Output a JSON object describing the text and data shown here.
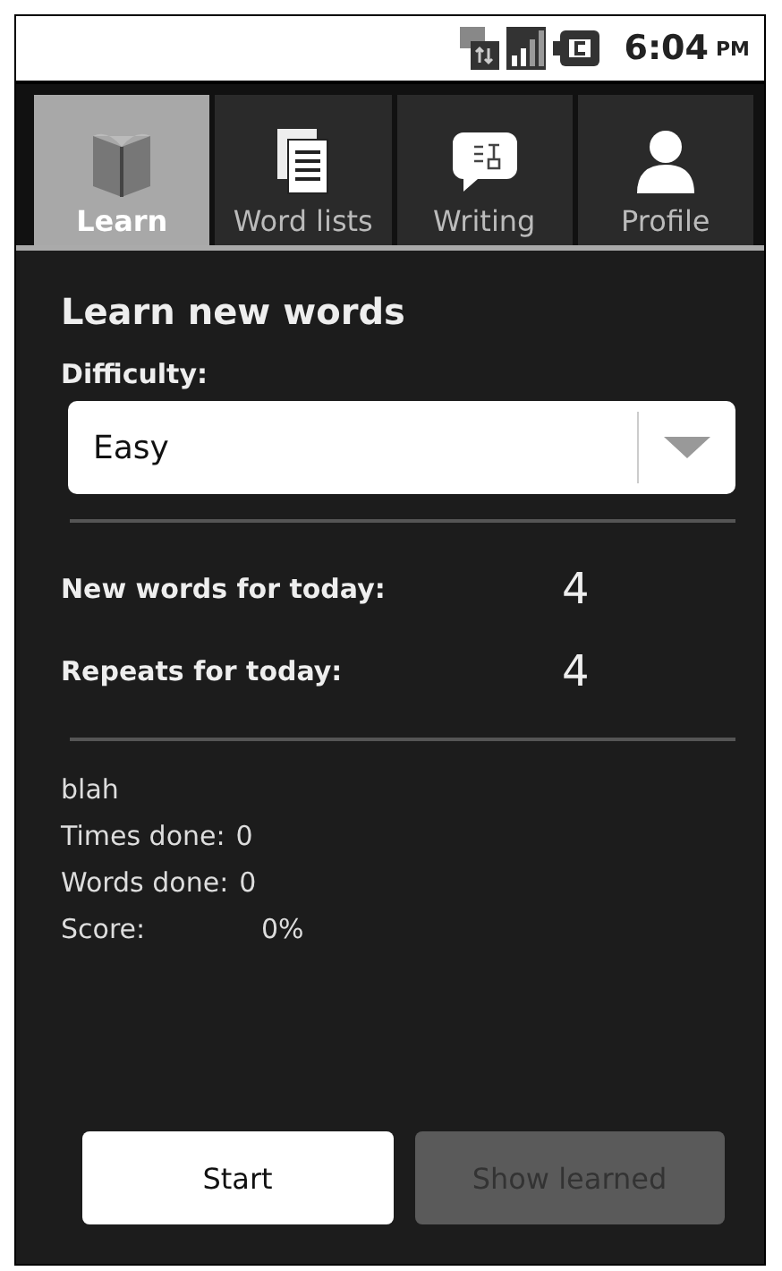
{
  "status_bar": {
    "time": "6:04",
    "ampm": "PM"
  },
  "tabs": [
    {
      "label": "Learn",
      "selected": true
    },
    {
      "label": "Word lists",
      "selected": false
    },
    {
      "label": "Writing",
      "selected": false
    },
    {
      "label": "Profile",
      "selected": false
    }
  ],
  "title": "Learn new words",
  "difficulty": {
    "label": "Difficulty:",
    "value": "Easy"
  },
  "counts": [
    {
      "label": "New words for today:",
      "value": "4"
    },
    {
      "label": "Repeats for today:",
      "value": "4"
    }
  ],
  "info": {
    "name": "blah",
    "lines": [
      {
        "label": "Times done:",
        "value": "0"
      },
      {
        "label": "Words done:",
        "value": "0"
      },
      {
        "label": "Score:",
        "value": "0%"
      }
    ]
  },
  "buttons": [
    {
      "label": "Start",
      "disabled": false
    },
    {
      "label": "Show learned",
      "disabled": true
    }
  ]
}
